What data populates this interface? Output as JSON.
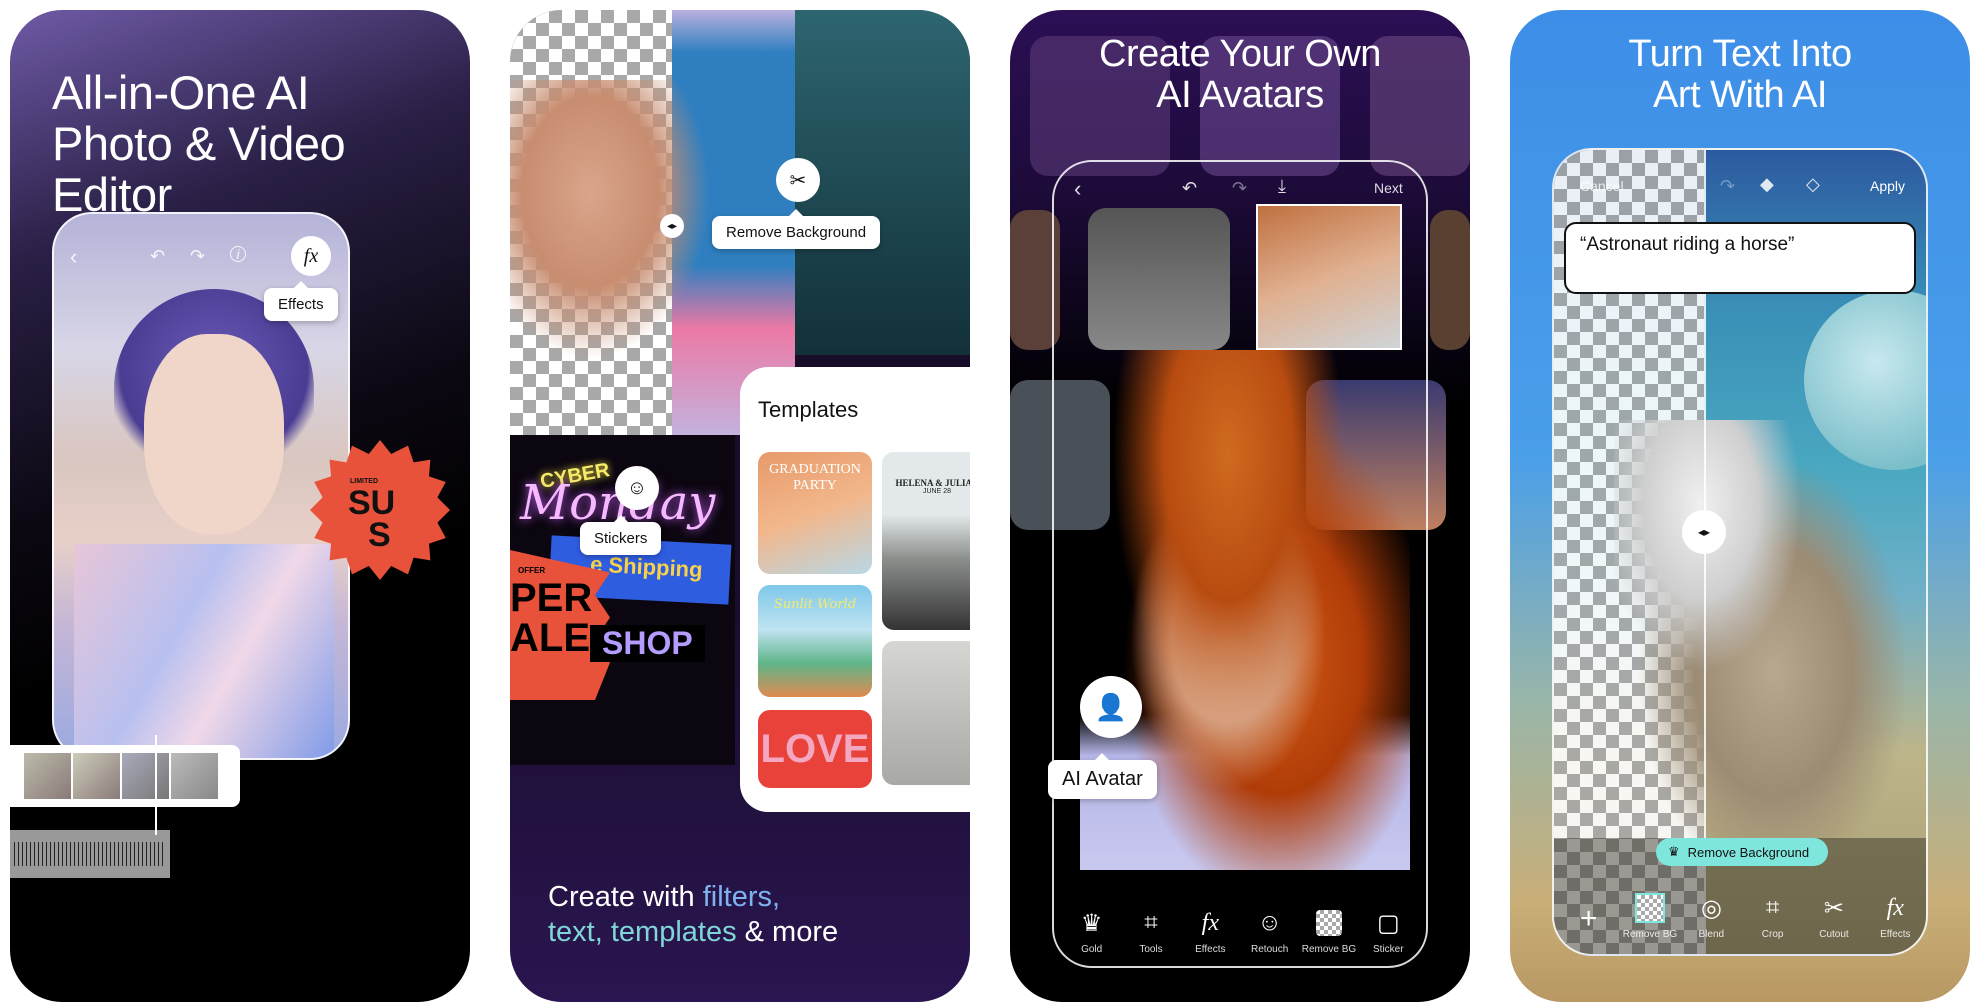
{
  "panels": [
    {
      "headline": [
        "All-in-One AI",
        "Photo & Video",
        "Editor"
      ],
      "top_icons": [
        "back-icon",
        "undo-icon",
        "redo-icon",
        "info-icon"
      ],
      "effects_button": "fx",
      "tooltip": "Effects",
      "sticker": {
        "small": "LIMITED",
        "big1": "SU",
        "big2": "S"
      }
    },
    {
      "tooltip_remove_bg": "Remove Background",
      "templates_title": "Templates",
      "templates": [
        {
          "title": "GRADUATION PARTY"
        },
        {
          "title": "HELENA & JULIAN",
          "sub": "JUNE 28"
        },
        {
          "title": "Sunlit World"
        },
        {
          "title": ""
        },
        {
          "title": "LOVE"
        }
      ],
      "cyber": "CYBER",
      "monday": "Monday",
      "shipping": "e Shipping",
      "offer": "OFFER",
      "sale1": "PER",
      "sale2": "ALE",
      "shop": "SHOP",
      "tooltip_stickers": "Stickers",
      "tagline": {
        "part1": "Create with ",
        "hl1": "filters,",
        "part2": "text, templates",
        "part3": " & more"
      }
    },
    {
      "headline": [
        "Create Your Own",
        "AI Avatars"
      ],
      "next": "Next",
      "tooltip": "AI Avatar",
      "tools": [
        {
          "icon": "crown-icon",
          "label": "Gold"
        },
        {
          "icon": "crop-icon",
          "label": "Tools"
        },
        {
          "icon": "fx-icon",
          "label": "Effects"
        },
        {
          "icon": "retouch-icon",
          "label": "Retouch"
        },
        {
          "icon": "remove-bg-icon",
          "label": "Remove BG"
        },
        {
          "icon": "sticker-icon",
          "label": "Sticker"
        }
      ]
    },
    {
      "headline": [
        "Turn Text Into",
        "Art With AI"
      ],
      "cancel": "Cancel",
      "apply": "Apply",
      "prompt": "“Astronaut riding a horse”",
      "pill": "Remove Background",
      "tools": [
        {
          "icon": "plus-icon",
          "label": ""
        },
        {
          "icon": "remove-bg-icon",
          "label": "Remove BG"
        },
        {
          "icon": "blend-icon",
          "label": "Blend"
        },
        {
          "icon": "crop-icon",
          "label": "Crop"
        },
        {
          "icon": "cutout-icon",
          "label": "Cutout"
        },
        {
          "icon": "fx-icon",
          "label": "Effects"
        }
      ]
    }
  ],
  "colors": {
    "accent_teal": "#7ee6dc",
    "sale_red": "#e8523a",
    "tagline_blue": "#7fb3ef",
    "tagline_teal": "#7fd6d6"
  }
}
